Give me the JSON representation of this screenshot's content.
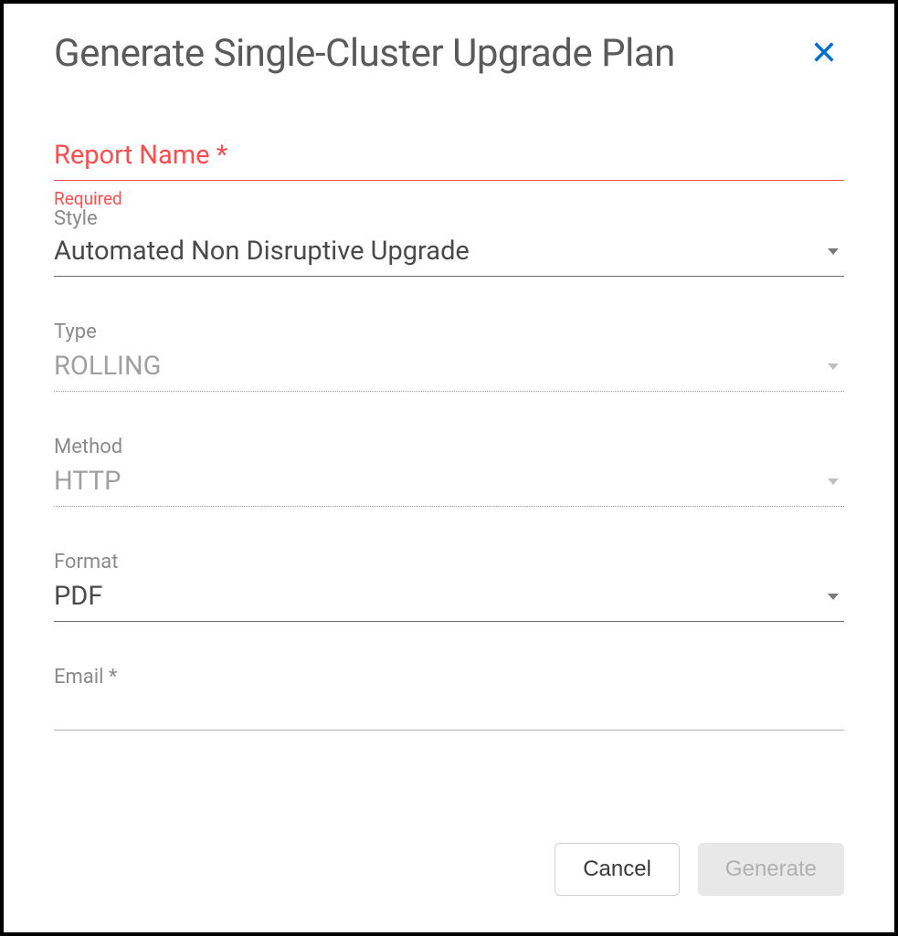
{
  "dialog": {
    "title": "Generate Single-Cluster Upgrade Plan"
  },
  "form": {
    "reportName": {
      "label": "Report Name *",
      "requiredText": "Required",
      "value": ""
    },
    "style": {
      "label": "Style",
      "value": "Automated Non Disruptive Upgrade"
    },
    "type": {
      "label": "Type",
      "value": "ROLLING"
    },
    "method": {
      "label": "Method",
      "value": "HTTP"
    },
    "format": {
      "label": "Format",
      "value": "PDF"
    },
    "email": {
      "label": "Email *",
      "value": ""
    }
  },
  "buttons": {
    "cancel": "Cancel",
    "generate": "Generate"
  }
}
